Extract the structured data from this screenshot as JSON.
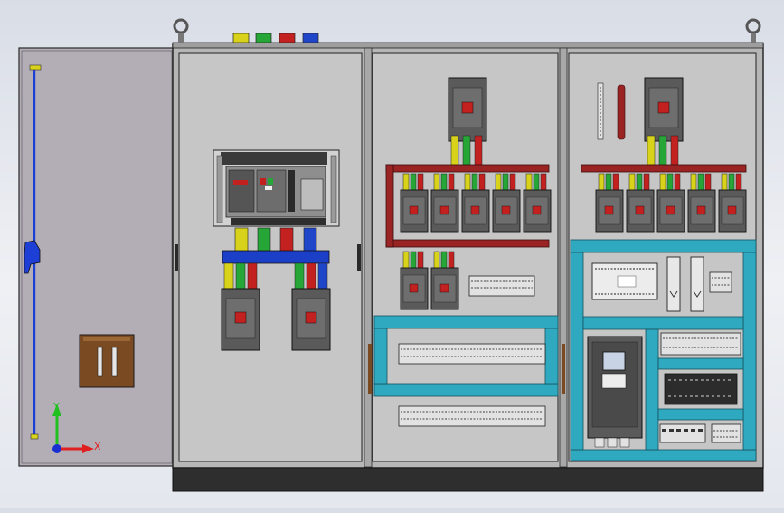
{
  "axis_triad": {
    "x_label": "X",
    "y_label": "Y",
    "x_color": "#e02020",
    "y_color": "#20c020",
    "z_color": "#1a2fd0"
  },
  "colors": {
    "cabinet_fill": "#b6b6b6",
    "panel_fill": "#c6c6c6",
    "door_fill": "#b3adb6",
    "plinth": "#2e2e2e",
    "busbar_red": "#9a2424",
    "busbar_blue": "#1c3fc8",
    "cable_tray": "#2fa9bf",
    "phase_yellow": "#d8d21a",
    "phase_green": "#26a636",
    "phase_red": "#c32020",
    "phase_blue": "#1f46c8",
    "breaker_body": "#5a5a5a",
    "door_handle": "#7a4a22",
    "door_rod": "#1e3fd6"
  },
  "phase_markers": [
    "yellow",
    "green",
    "red",
    "blue"
  ],
  "components": [
    "left-door",
    "air-circuit-breaker",
    "main-busbar-assembly",
    "molded-case-breakers",
    "terminal-blocks",
    "plc-controller",
    "variable-frequency-drive",
    "relay-bank",
    "cable-trays"
  ]
}
